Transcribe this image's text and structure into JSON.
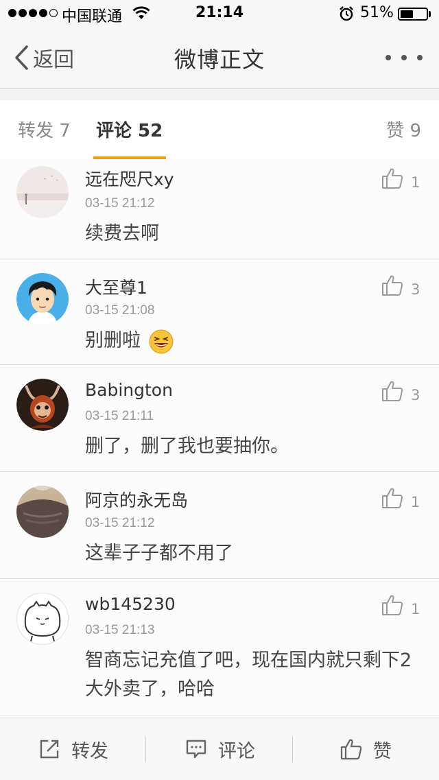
{
  "status_bar": {
    "carrier": "中国联通",
    "time": "21:14",
    "battery_percent": "51%",
    "battery_level": 0.51,
    "signal_bars_filled": 4,
    "signal_bars_total": 5
  },
  "nav": {
    "back_label": "返回",
    "title": "微博正文"
  },
  "tabs": {
    "repost": "转发 7",
    "comment": "评论 52",
    "like": "赞 9",
    "active": "comment",
    "accent_color": "#f09a23"
  },
  "comments": [
    {
      "username": "远在咫尺xy",
      "time": "03-15 21:12",
      "text": "续费去啊",
      "likes": "1"
    },
    {
      "username": "大至尊1",
      "time": "03-15 21:08",
      "text": "别删啦",
      "likes": "3",
      "emoji": "laughing-emoji"
    },
    {
      "username": "Babington",
      "time": "03-15 21:11",
      "text": "删了，删了我也要抽你。",
      "likes": "3"
    },
    {
      "username": "阿京的永无岛",
      "time": "03-15 21:12",
      "text": "这辈子子都不用了",
      "likes": "1"
    },
    {
      "username": "wb145230",
      "time": "03-15 21:13",
      "text": "智商忘记充值了吧，现在国内就只剩下2大外卖了，哈哈",
      "likes": "1"
    }
  ],
  "bottom_bar": {
    "repost": "转发",
    "comment": "评论",
    "like": "赞"
  }
}
